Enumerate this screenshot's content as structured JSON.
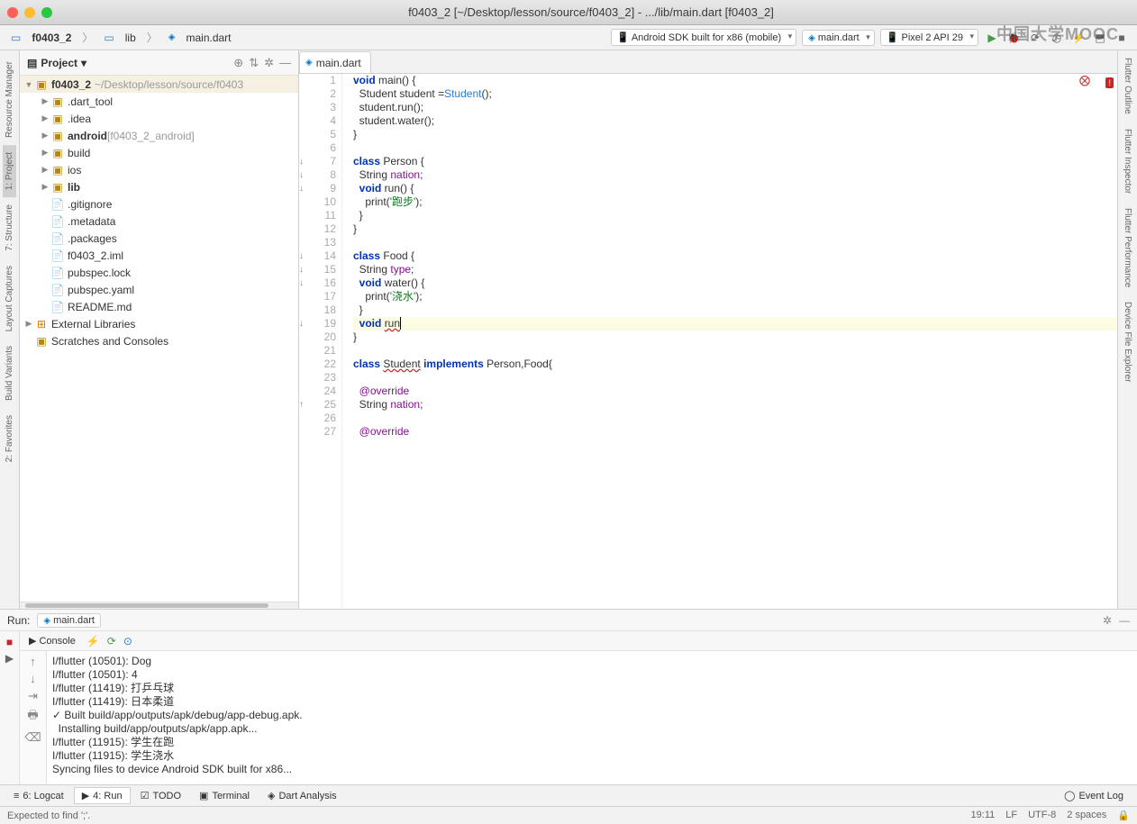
{
  "title": "f0403_2 [~/Desktop/lesson/source/f0403_2] - .../lib/main.dart [f0403_2]",
  "breadcrumb": {
    "root": "f0403_2",
    "dir": "lib",
    "file": "main.dart"
  },
  "toolbar": {
    "device": "Android SDK built for x86 (mobile)",
    "config": "main.dart",
    "emulator": "Pixel 2 API 29"
  },
  "watermark": "中国大学MOOC",
  "project": {
    "label": "Project",
    "root": "f0403_2",
    "root_path": "~/Desktop/lesson/source/f0403",
    "items": [
      {
        "label": ".dart_tool",
        "type": "folder",
        "indent": 1,
        "arrow": "▶"
      },
      {
        "label": ".idea",
        "type": "folder",
        "indent": 1,
        "arrow": "▶"
      },
      {
        "label": "android",
        "type": "folder",
        "indent": 1,
        "arrow": "▶",
        "suffix": "[f0403_2_android]",
        "bold": true
      },
      {
        "label": "build",
        "type": "folder",
        "indent": 1,
        "arrow": "▶"
      },
      {
        "label": "ios",
        "type": "folder",
        "indent": 1,
        "arrow": "▶"
      },
      {
        "label": "lib",
        "type": "folder",
        "indent": 1,
        "arrow": "▶",
        "bold": true
      },
      {
        "label": ".gitignore",
        "type": "file",
        "indent": 1
      },
      {
        "label": ".metadata",
        "type": "file",
        "indent": 1
      },
      {
        "label": ".packages",
        "type": "file",
        "indent": 1
      },
      {
        "label": "f0403_2.iml",
        "type": "file",
        "indent": 1
      },
      {
        "label": "pubspec.lock",
        "type": "file",
        "indent": 1
      },
      {
        "label": "pubspec.yaml",
        "type": "file",
        "indent": 1
      },
      {
        "label": "README.md",
        "type": "file",
        "indent": 1
      }
    ],
    "external": "External Libraries",
    "scratches": "Scratches and Consoles"
  },
  "editor": {
    "tab": "main.dart",
    "lines": [
      {
        "n": 1,
        "mark": "",
        "html": "<span class='kw-blue'>void</span> <span class='ident'>main</span>() {"
      },
      {
        "n": 2,
        "mark": "",
        "html": "  Student student =<span class='type'>Student</span>();"
      },
      {
        "n": 3,
        "mark": "",
        "html": "  student.run();"
      },
      {
        "n": 4,
        "mark": "",
        "html": "  student.water();"
      },
      {
        "n": 5,
        "mark": "",
        "html": "}"
      },
      {
        "n": 6,
        "mark": "",
        "html": ""
      },
      {
        "n": 7,
        "mark": "●↓",
        "html": "<span class='kw-blue'>class</span> Person {"
      },
      {
        "n": 8,
        "mark": "●↓",
        "html": "  String <span class='purple'>nation</span>;"
      },
      {
        "n": 9,
        "mark": "●↓",
        "html": "  <span class='kw-blue'>void</span> run() {"
      },
      {
        "n": 10,
        "mark": "",
        "html": "    print(<span class='str'>'跑步'</span>);"
      },
      {
        "n": 11,
        "mark": "",
        "html": "  }"
      },
      {
        "n": 12,
        "mark": "",
        "html": "}"
      },
      {
        "n": 13,
        "mark": "",
        "html": ""
      },
      {
        "n": 14,
        "mark": "●↓",
        "html": "<span class='kw-blue'>class</span> Food {"
      },
      {
        "n": 15,
        "mark": "●↓",
        "html": "  String <span class='purple'>type</span>;"
      },
      {
        "n": 16,
        "mark": "●↓",
        "html": "  <span class='kw-blue'>void</span> water() {"
      },
      {
        "n": 17,
        "mark": "",
        "html": "    print(<span class='str'>'浇水'</span>);"
      },
      {
        "n": 18,
        "mark": "",
        "err": true,
        "html": "  <span class='gutter-err'>⨂</span>}"
      },
      {
        "n": 19,
        "mark": "●↓",
        "hl": true,
        "html": "  <span class='kw-blue'>void</span> <span class='err-underline'>run</span><span class='caret'></span>"
      },
      {
        "n": 20,
        "mark": "",
        "html": "}"
      },
      {
        "n": 21,
        "mark": "",
        "html": ""
      },
      {
        "n": 22,
        "mark": "",
        "html": "<span class='kw-blue'>class</span> <span class='err-underline'>Student</span> <span class='kw-blue'>implements</span> Person,Food{"
      },
      {
        "n": 23,
        "mark": "",
        "html": ""
      },
      {
        "n": 24,
        "mark": "",
        "html": "  <span class='purple'>@override</span>"
      },
      {
        "n": 25,
        "mark": "●↑",
        "html": "  String <span class='purple'>nation</span>;"
      },
      {
        "n": 26,
        "mark": "",
        "html": ""
      },
      {
        "n": 27,
        "mark": "",
        "html": "  <span class='purple'>@override</span>"
      }
    ]
  },
  "run": {
    "label": "Run:",
    "tab": "main.dart",
    "console_label": "Console",
    "output": [
      "I/flutter (10501): Dog",
      "I/flutter (10501): 4",
      "I/flutter (11419): 打乒乓球",
      "I/flutter (11419): 日本柔道",
      "✓ Built build/app/outputs/apk/debug/app-debug.apk.",
      "  Installing build/app/outputs/apk/app.apk...",
      "I/flutter (11915): 学生在跑",
      "I/flutter (11915): 学生浇水",
      "Syncing files to device Android SDK built for x86..."
    ]
  },
  "bottom_tabs": {
    "logcat": "6: Logcat",
    "run": "4: Run",
    "todo": "TODO",
    "terminal": "Terminal",
    "dart": "Dart Analysis",
    "eventlog": "Event Log"
  },
  "status": {
    "msg": "Expected to find ';'.",
    "pos": "19:11",
    "lf": "LF",
    "enc": "UTF-8",
    "indent": "2 spaces"
  },
  "side_tabs": {
    "left": [
      "Resource Manager",
      "1: Project",
      "7: Structure",
      "Layout Captures",
      "Build Variants",
      "2: Favorites"
    ],
    "right": [
      "Flutter Outline",
      "Flutter Inspector",
      "Flutter Performance",
      "Device File Explorer"
    ]
  }
}
